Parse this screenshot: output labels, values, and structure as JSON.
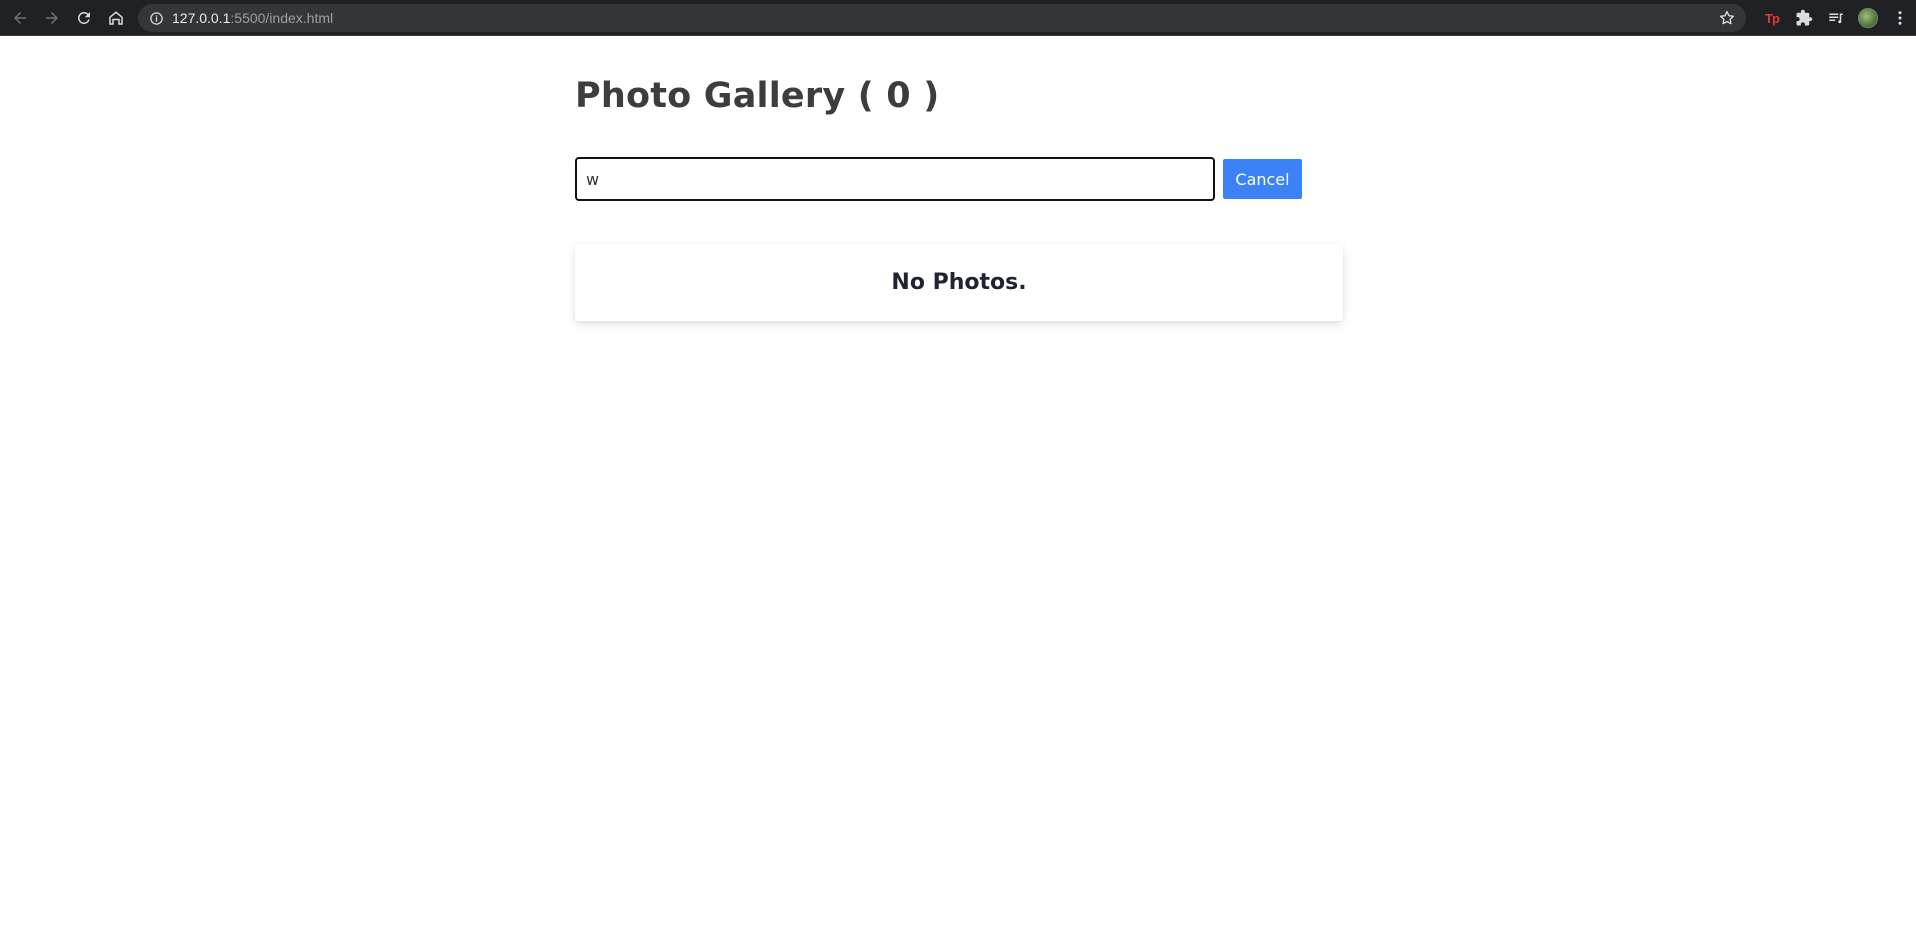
{
  "browser": {
    "url_host": "127.0.0.1",
    "url_path": ":5500/index.html",
    "icons": [
      "back-arrow-icon",
      "forward-arrow-icon",
      "reload-icon",
      "home-icon",
      "site-info-icon",
      "bookmark-star-icon",
      "extension-puzzle-icon",
      "reading-list-icon",
      "profile-avatar",
      "more-menu-icon"
    ],
    "extension_tp_label": "Tp"
  },
  "gallery": {
    "title": "Photo Gallery ( 0 )",
    "search_value": "w",
    "cancel_label": "Cancel",
    "empty_message": "No Photos."
  },
  "colors": {
    "primary_button": "#3b82f6",
    "title_text": "#3d3d3d",
    "empty_text": "#1f2433"
  }
}
